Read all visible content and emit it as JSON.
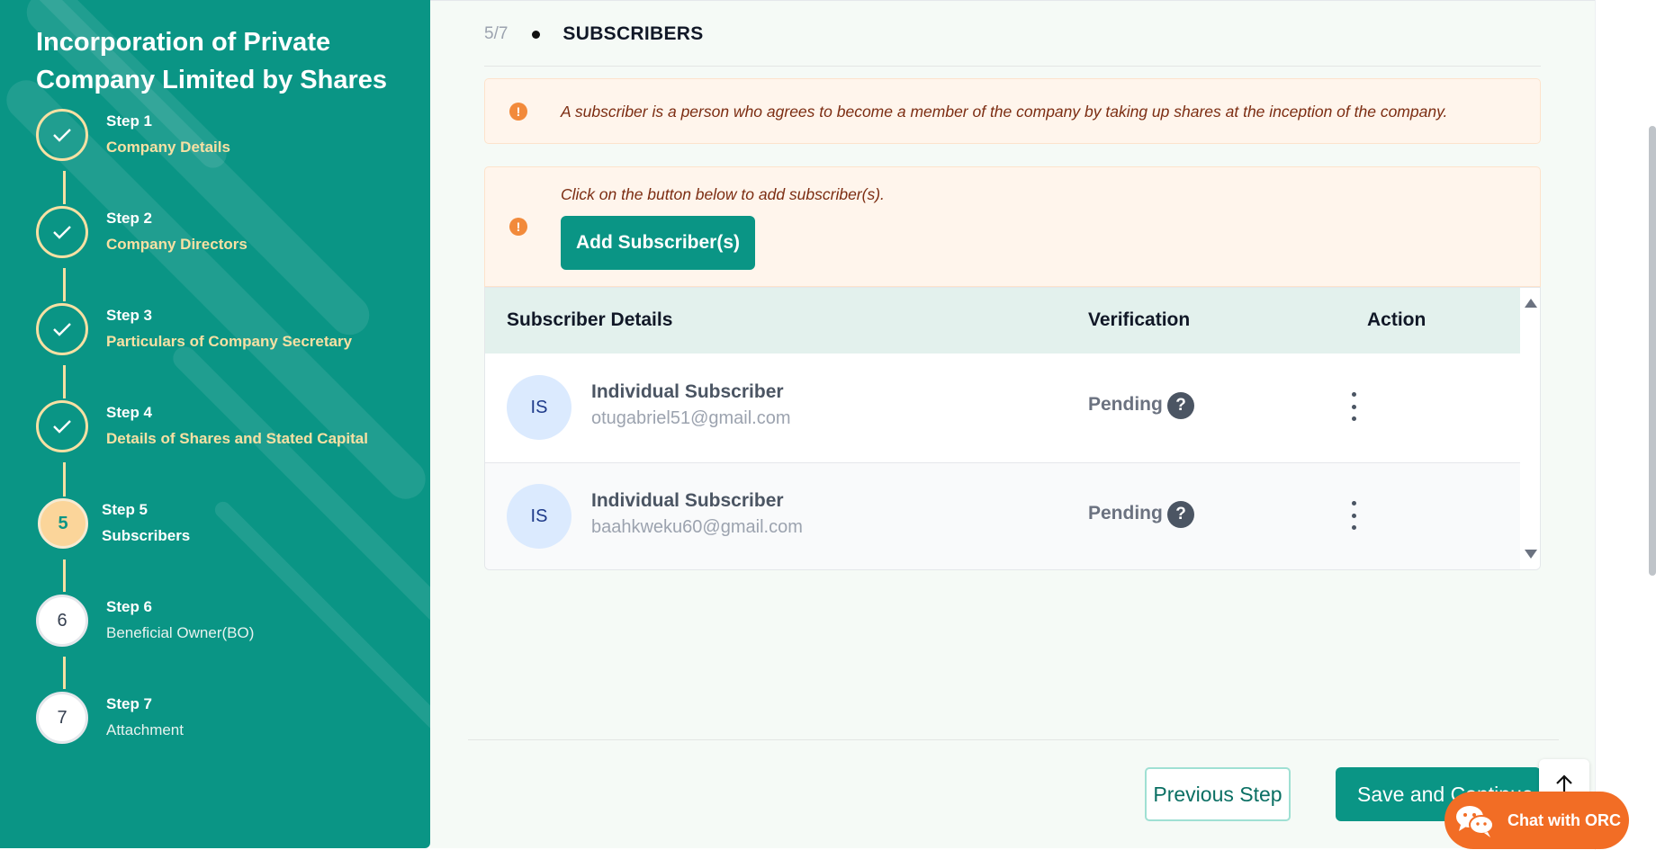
{
  "sidebar": {
    "title": "Incorporation of Private Company Limited by Shares",
    "steps": [
      {
        "label": "Step 1",
        "name": "Company Details",
        "state": "done"
      },
      {
        "label": "Step 2",
        "name": "Company Directors",
        "state": "done"
      },
      {
        "label": "Step 3",
        "name": "Particulars of Company Secretary",
        "state": "done"
      },
      {
        "label": "Step 4",
        "name": "Details of Shares and Stated Capital",
        "state": "done"
      },
      {
        "label": "Step 5",
        "name": "Subscribers",
        "state": "active",
        "number": "5"
      },
      {
        "label": "Step 6",
        "name": "Beneficial Owner(BO)",
        "state": "todo",
        "number": "6"
      },
      {
        "label": "Step 7",
        "name": "Attachment",
        "state": "todo",
        "number": "7"
      }
    ]
  },
  "section": {
    "counter": "5/7",
    "title": "SUBSCRIBERS"
  },
  "info_alert": "A subscriber is a person who agrees to become a member of the company by taking up shares at the inception of the company.",
  "add_alert": {
    "text": "Click on the button below to add subscriber(s).",
    "button": "Add Subscriber(s)"
  },
  "table": {
    "headers": [
      "Subscriber Details",
      "Verification",
      "Action"
    ],
    "rows": [
      {
        "initials": "IS",
        "name": "Individual Subscriber",
        "email": "otugabriel51@gmail.com",
        "status": "Pending"
      },
      {
        "initials": "IS",
        "name": "Individual Subscriber",
        "email": "baahkweku60@gmail.com",
        "status": "Pending"
      }
    ]
  },
  "footer": {
    "previous": "Previous Step",
    "save": "Save and Continue"
  },
  "chat": {
    "label": "Chat with ORC"
  },
  "colors": {
    "brand": "#0a9585",
    "accent": "#f7e0a3",
    "chat": "#f26d25"
  }
}
